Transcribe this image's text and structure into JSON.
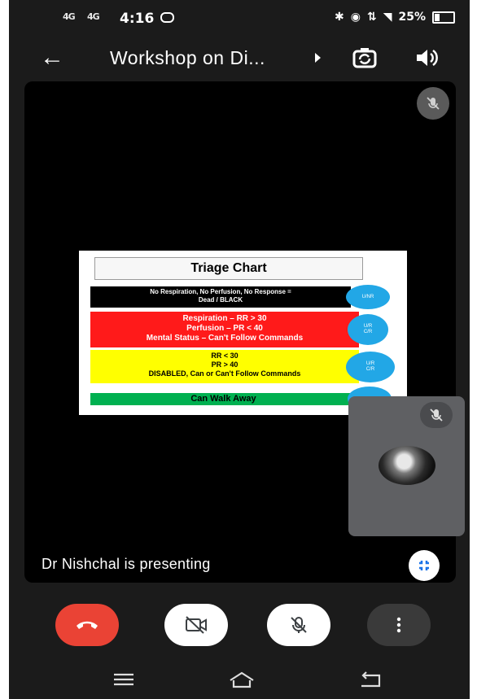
{
  "status_bar": {
    "sim1": "4G",
    "sim2": "4G",
    "time": "4:16",
    "battery": "25%"
  },
  "top_bar": {
    "title": "Workshop on Di..."
  },
  "slide": {
    "heading": "Triage Chart",
    "bands": [
      {
        "lines": [
          "No Respiration, No Perfusion, No Response =",
          "Dead / BLACK"
        ],
        "color": "#000000"
      },
      {
        "lines": [
          "Respiration – RR > 30",
          "Perfusion – PR < 40",
          "Mental Status – Can't Follow Commands"
        ],
        "color": "#ff1a1a"
      },
      {
        "lines": [
          "RR < 30",
          "PR > 40",
          "DISABLED, Can or Can't Follow Commands"
        ],
        "color": "#ffff00"
      },
      {
        "lines": [
          "Can Walk Away"
        ],
        "color": "#00b050"
      }
    ]
  },
  "presenting_text": "Dr Nishchal is presenting",
  "colors": {
    "end_call": "#ea4335",
    "self_tile": "#5f6063",
    "accent": "#1a73e8"
  }
}
